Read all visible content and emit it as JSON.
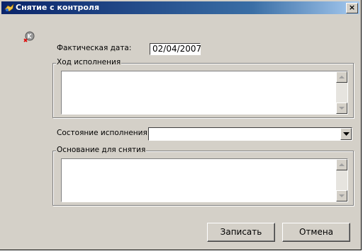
{
  "window": {
    "title": "Снятие с контроля",
    "close_glyph": "×"
  },
  "form": {
    "actual_date_label": "Фактическая дата:",
    "actual_date_value": "02/04/2007",
    "progress_group_label": "Ход исполнения",
    "progress_text": "",
    "status_label": "Состояние исполнения:",
    "status_value": "",
    "reason_group_label": "Основание для снятия",
    "reason_text": ""
  },
  "buttons": {
    "save": "Записать",
    "cancel": "Отмена"
  },
  "icons": {
    "title": "app-icon",
    "status": "remove-control-icon"
  }
}
